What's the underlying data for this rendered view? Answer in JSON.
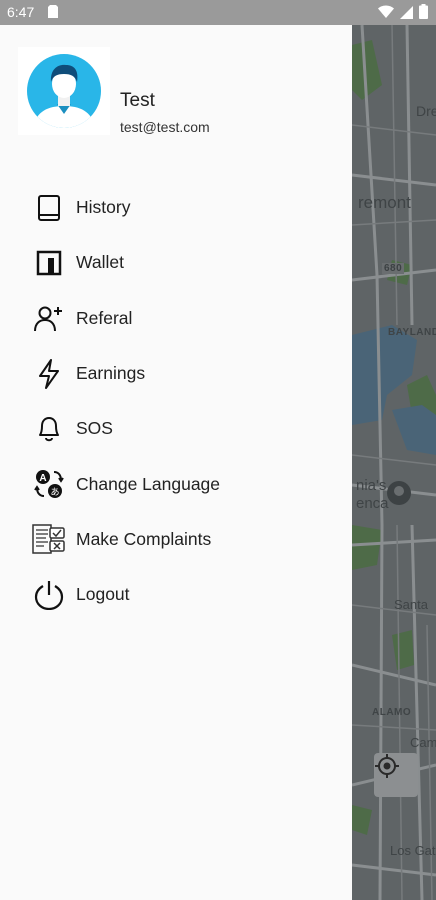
{
  "status_bar": {
    "time": "6:47"
  },
  "user": {
    "name": "Test",
    "email": "test@test.com"
  },
  "menu": [
    {
      "label": "History",
      "icon": "book-icon"
    },
    {
      "label": "Wallet",
      "icon": "wallet-icon"
    },
    {
      "label": "Referal",
      "icon": "add-user-icon"
    },
    {
      "label": "Earnings",
      "icon": "lightning-icon"
    },
    {
      "label": "SOS",
      "icon": "bell-icon"
    },
    {
      "label": "Change Language",
      "icon": "translate-icon"
    },
    {
      "label": "Make Complaints",
      "icon": "complaint-form-icon"
    },
    {
      "label": "Logout",
      "icon": "power-icon"
    }
  ],
  "map": {
    "labels": [
      "Dres",
      "remont",
      "680",
      "BAYLANDS",
      "nia's",
      "enca",
      "Santa",
      "ALAMO",
      "Cam",
      "Los Gato"
    ]
  },
  "colors": {
    "drawer_bg": "#fafafa",
    "avatar_blue": "#29b6e8",
    "scrim": "#6f7477"
  }
}
